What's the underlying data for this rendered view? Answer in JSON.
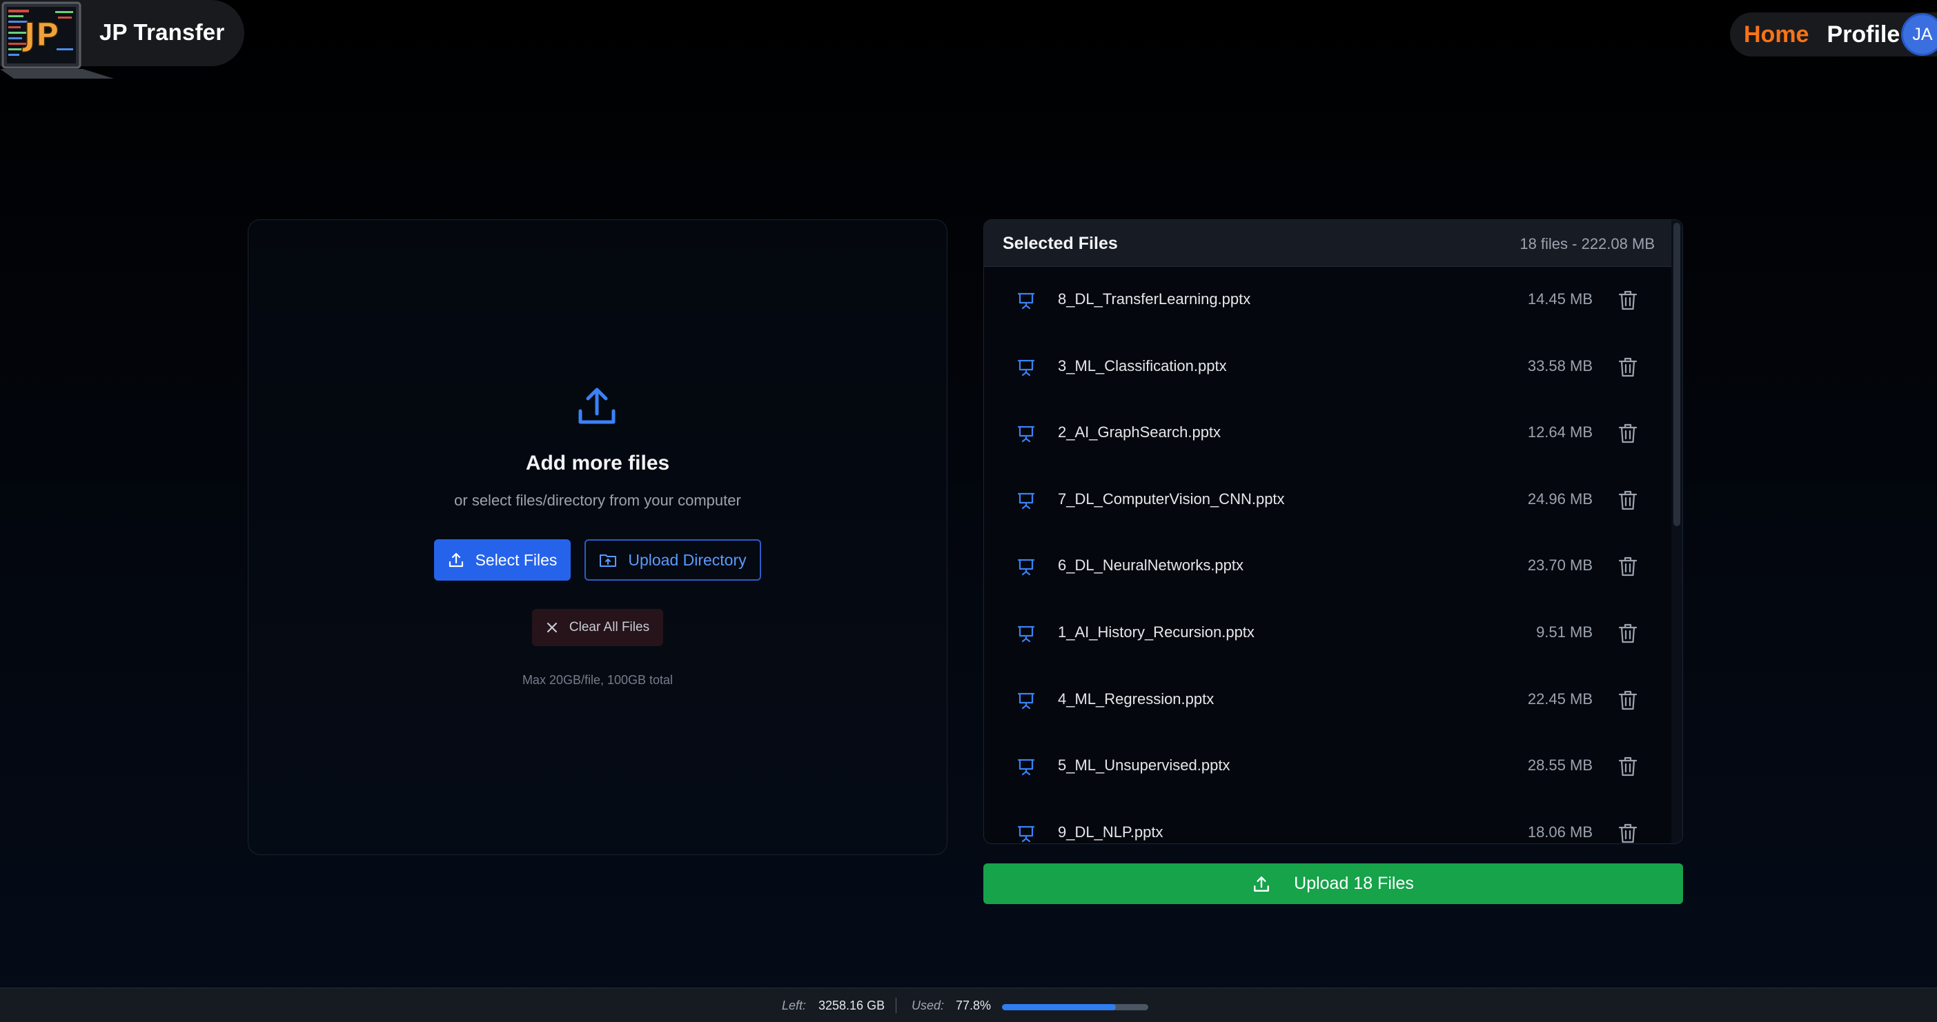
{
  "header": {
    "app_name": "JP Transfer",
    "logo_text": "JP",
    "nav": {
      "home": "Home",
      "profile": "Profile"
    },
    "avatar_initials": "JA"
  },
  "dropzone": {
    "title": "Add more files",
    "subtitle": "or select files/directory from your computer",
    "select_files_label": "Select Files",
    "upload_directory_label": "Upload Directory",
    "clear_all_label": "Clear All Files",
    "limit_text": "Max 20GB/file, 100GB total"
  },
  "selected_files": {
    "title": "Selected Files",
    "summary": "18 files - 222.08 MB",
    "files": [
      {
        "name": "8_DL_TransferLearning.pptx",
        "size": "14.45 MB"
      },
      {
        "name": "3_ML_Classification.pptx",
        "size": "33.58 MB"
      },
      {
        "name": "2_AI_GraphSearch.pptx",
        "size": "12.64 MB"
      },
      {
        "name": "7_DL_ComputerVision_CNN.pptx",
        "size": "24.96 MB"
      },
      {
        "name": "6_DL_NeuralNetworks.pptx",
        "size": "23.70 MB"
      },
      {
        "name": "1_AI_History_Recursion.pptx",
        "size": "9.51 MB"
      },
      {
        "name": "4_ML_Regression.pptx",
        "size": "22.45 MB"
      },
      {
        "name": "5_ML_Unsupervised.pptx",
        "size": "28.55 MB"
      },
      {
        "name": "9_DL_NLP.pptx",
        "size": "18.06 MB"
      }
    ]
  },
  "upload_button_label": "Upload 18 Files",
  "footer": {
    "left_label": "Left:",
    "left_value": "3258.16 GB",
    "used_label": "Used:",
    "used_value": "77.8%",
    "used_fraction": 0.778
  },
  "colors": {
    "accent": "#2563eb",
    "home_active": "#f97316",
    "upload_green": "#16a34a"
  },
  "icons": {
    "upload": "upload-icon",
    "folder_upload": "folder-upload-icon",
    "clear": "close-icon",
    "file": "presentation-icon",
    "delete": "trash-icon"
  }
}
